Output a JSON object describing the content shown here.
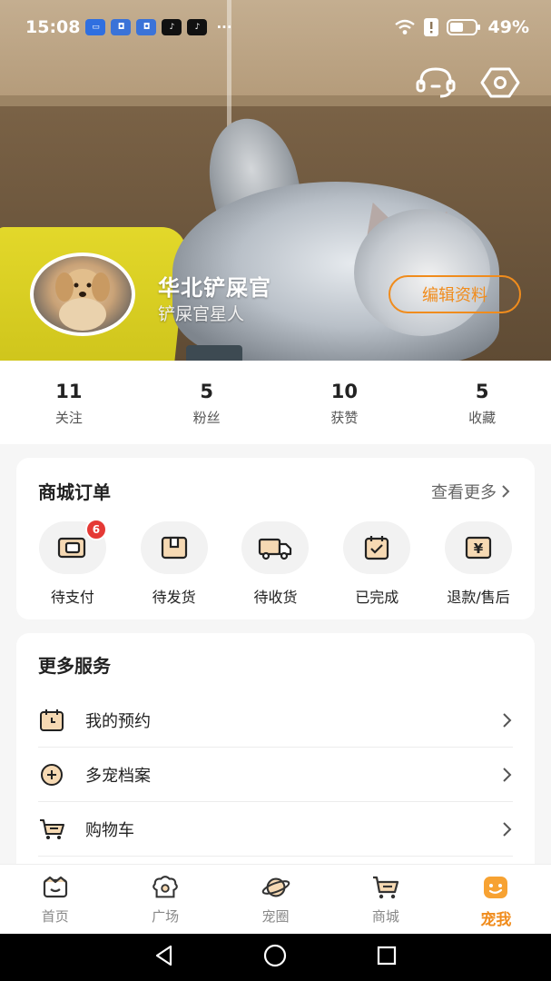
{
  "status_bar": {
    "time": "15:08",
    "battery": "49%",
    "app_icons": [
      "honor-icon",
      "app-shield-icon",
      "app-shield-icon",
      "tiktok-icon",
      "tiktok-icon"
    ],
    "more": "···"
  },
  "header": {
    "top_icons": [
      "customer-service-icon",
      "settings-icon"
    ]
  },
  "profile": {
    "name": "华北铲屎官",
    "tag": "铲屎官星人",
    "edit_label": "编辑资料"
  },
  "stats": [
    {
      "value": "11",
      "label": "关注"
    },
    {
      "value": "5",
      "label": "粉丝"
    },
    {
      "value": "10",
      "label": "获赞"
    },
    {
      "value": "5",
      "label": "收藏"
    }
  ],
  "orders_card": {
    "title": "商城订单",
    "more_label": "查看更多",
    "items": [
      {
        "label": "待支付",
        "icon": "wallet-icon",
        "badge": "6"
      },
      {
        "label": "待发货",
        "icon": "box-icon"
      },
      {
        "label": "待收货",
        "icon": "truck-icon"
      },
      {
        "label": "已完成",
        "icon": "calendar-check-icon"
      },
      {
        "label": "退款/售后",
        "icon": "yen-icon"
      }
    ]
  },
  "services_card": {
    "title": "更多服务",
    "items": [
      {
        "label": "我的预约",
        "icon": "appointment-icon"
      },
      {
        "label": "多宠档案",
        "icon": "plus-circle-icon"
      },
      {
        "label": "购物车",
        "icon": "cart-icon"
      }
    ]
  },
  "tabbar": {
    "items": [
      {
        "label": "首页",
        "icon": "home-icon"
      },
      {
        "label": "广场",
        "icon": "square-icon"
      },
      {
        "label": "宠圈",
        "icon": "planet-icon"
      },
      {
        "label": "商城",
        "icon": "shop-cart-icon"
      },
      {
        "label": "宠我",
        "icon": "me-icon",
        "active": true
      }
    ]
  },
  "colors": {
    "accent": "#f08c1d",
    "badge": "#e53935"
  }
}
